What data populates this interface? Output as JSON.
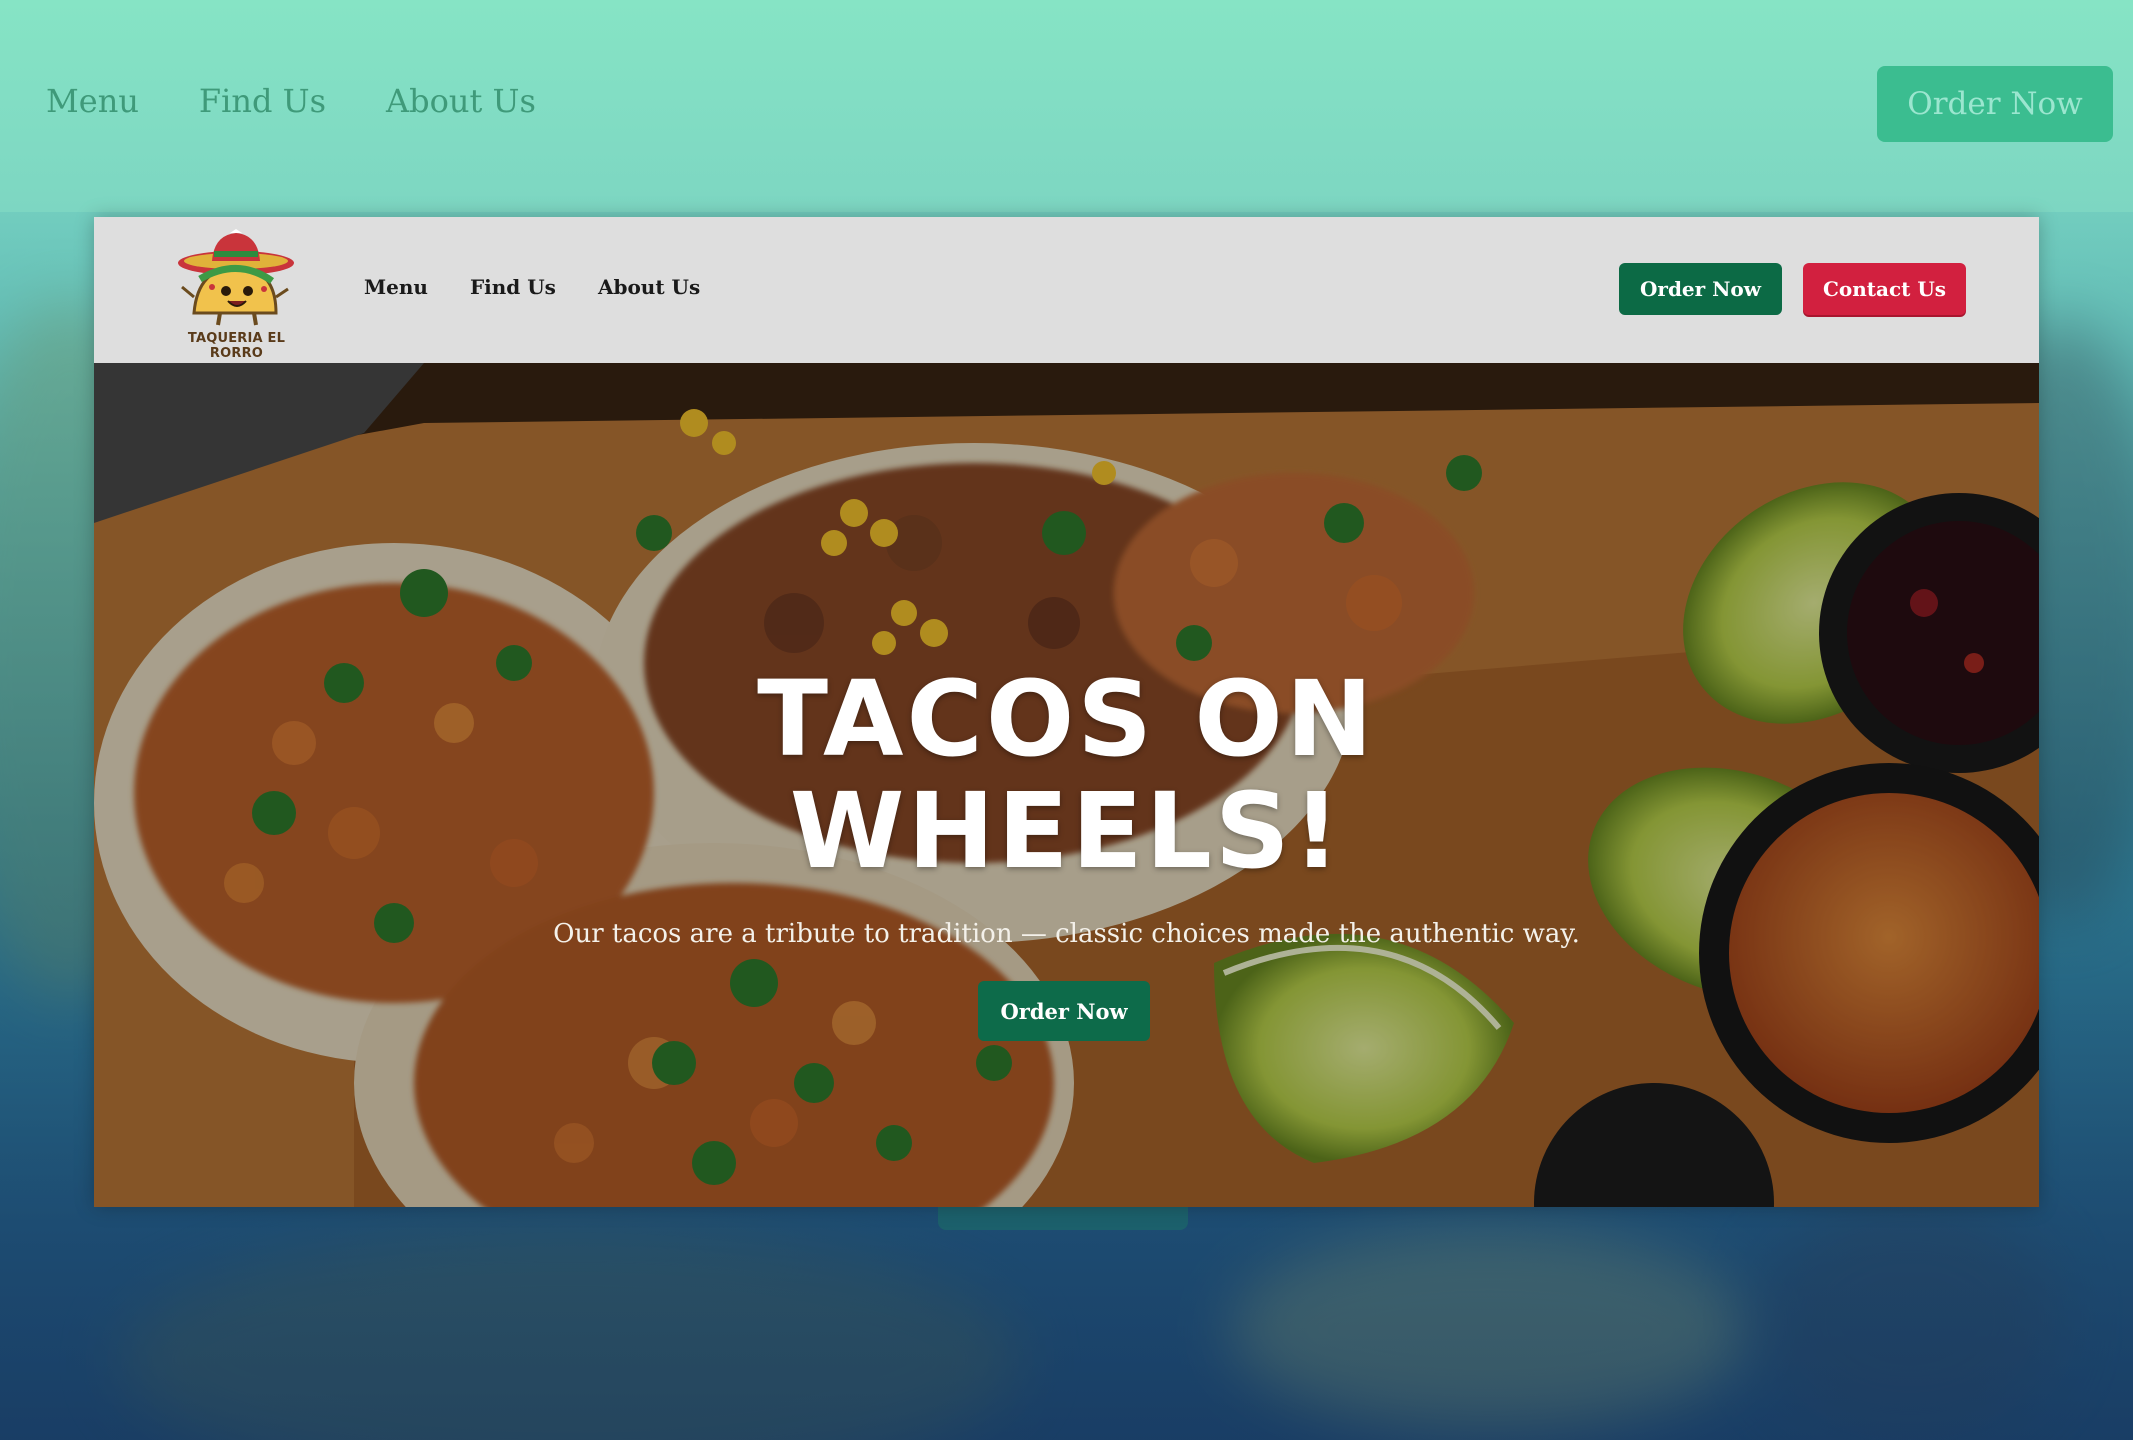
{
  "outer_nav": {
    "links": [
      "Menu",
      "Find Us",
      "About Us"
    ],
    "order_label": "Order Now"
  },
  "header": {
    "logo_text": "TAQUERIA EL RORRO",
    "nav": [
      {
        "label": "Menu"
      },
      {
        "label": "Find Us"
      },
      {
        "label": "About Us"
      }
    ],
    "order_label": "Order Now",
    "contact_label": "Contact Us"
  },
  "hero": {
    "title_line1": "TACOS ON",
    "title_line2": "WHEELS!",
    "subtitle": "Our tacos are a tribute to tradition — classic choices made the authentic way.",
    "cta_label": "Order Now"
  },
  "colors": {
    "brand_green": "#0c6a45",
    "accent_red": "#d2203f",
    "mint": "#82e2c2"
  }
}
